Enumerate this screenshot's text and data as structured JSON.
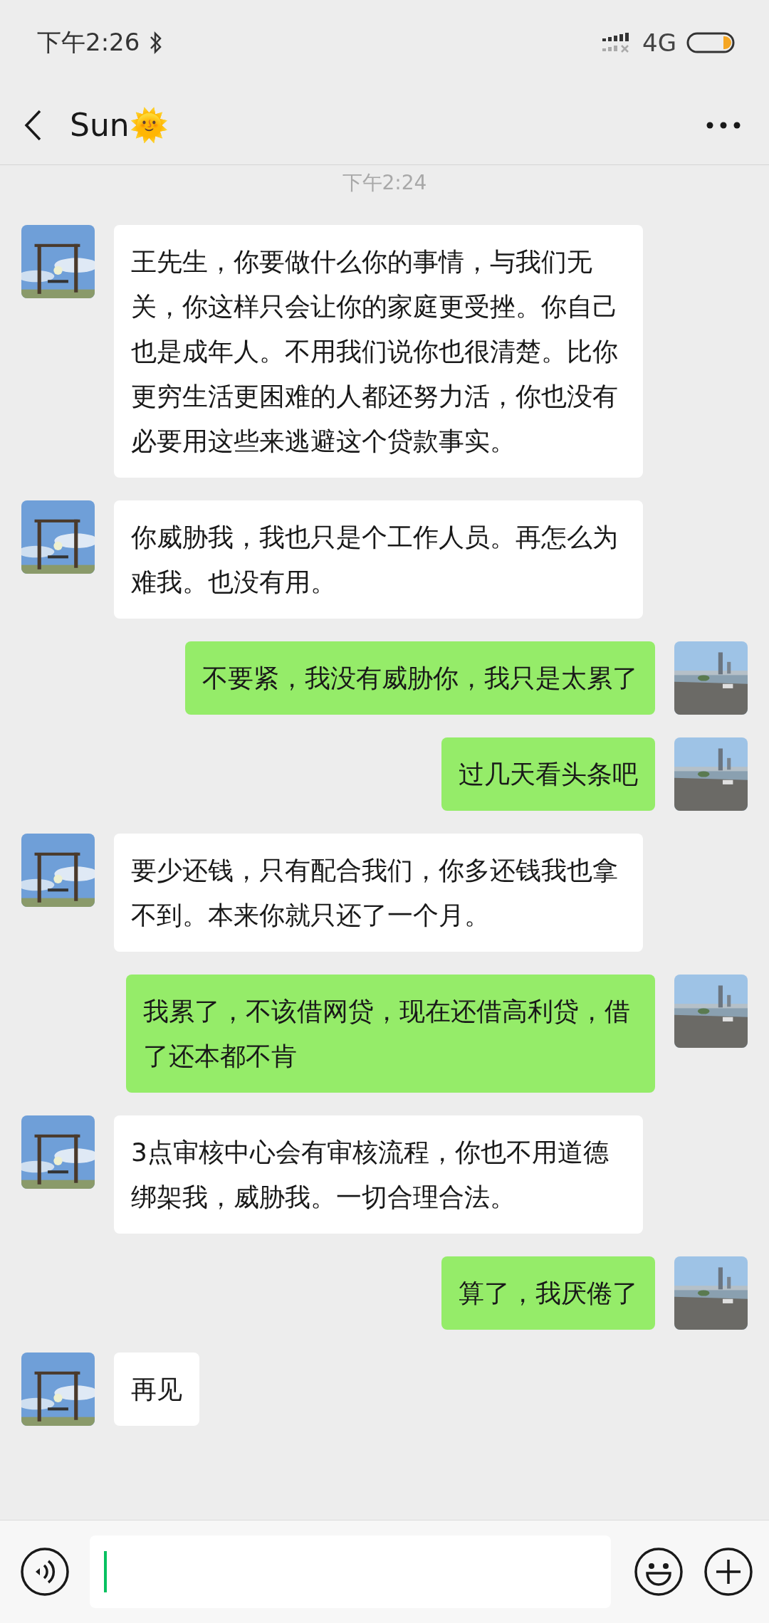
{
  "status_bar": {
    "time": "下午2:26",
    "network": "4G"
  },
  "header": {
    "title": "Sun🌞"
  },
  "timestamp": "下午2:24",
  "messages": [
    {
      "kind": "received",
      "text": "王先生，你要做什么你的事情，与我们无关，你这样只会让你的家庭更受挫。你自己也是成年人。不用我们说你也很清楚。比你更穷生活更困难的人都还努力活，你也没有必要用这些来逃避这个贷款事实。"
    },
    {
      "kind": "received",
      "text": "你威胁我，我也只是个工作人员。再怎么为难我。也没有用。"
    },
    {
      "kind": "sent",
      "text": "不要紧，我没有威胁你，我只是太累了"
    },
    {
      "kind": "sent",
      "text": "过几天看头条吧"
    },
    {
      "kind": "received",
      "text": "要少还钱，只有配合我们，你多还钱我也拿不到。本来你就只还了一个月。"
    },
    {
      "kind": "sent",
      "text": "我累了，不该借网贷，现在还借高利贷，借了还本都不肯"
    },
    {
      "kind": "received",
      "text": "3点审核中心会有审核流程，你也不用道德绑架我，威胁我。一切合理合法。"
    },
    {
      "kind": "sent",
      "text": "算了，我厌倦了"
    },
    {
      "kind": "received",
      "text": "再见"
    }
  ]
}
